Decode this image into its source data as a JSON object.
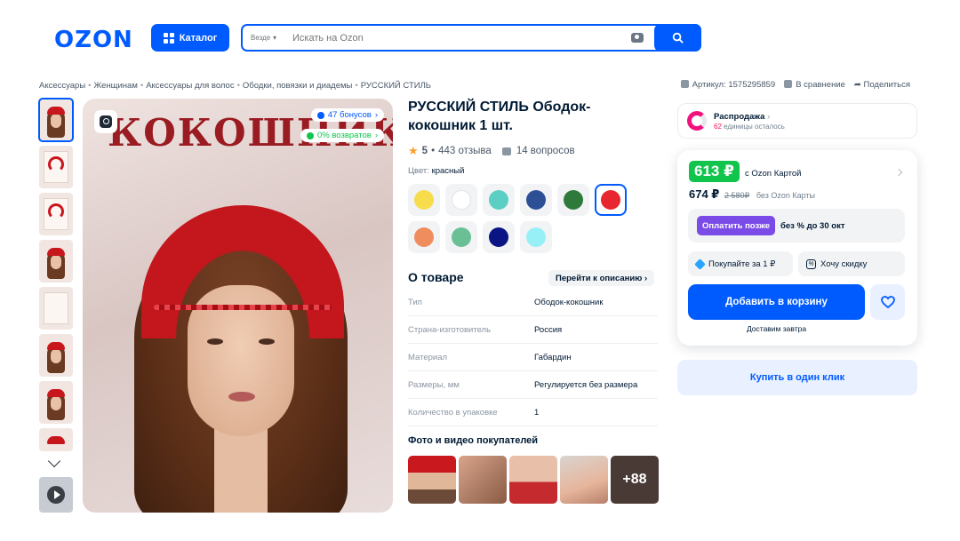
{
  "header": {
    "logo": "OZON",
    "catalog_label": "Каталог",
    "search_scope": "Везде",
    "search_placeholder": "Искать на Ozon"
  },
  "breadcrumbs": [
    "Аксессуары",
    "Женщинам",
    "Аксессуары для волос",
    "Ободки, повязки и диадемы",
    "РУССКИЙ СТИЛЬ"
  ],
  "meta": {
    "article": "Артикул: 1575295859",
    "compare": "В сравнение",
    "share": "Поделиться"
  },
  "gallery": {
    "main_word": "КОКОШНИК",
    "bonus_badge": "47 бонусов",
    "return_badge": "0% возвратов"
  },
  "product": {
    "title": "РУССКИЙ СТИЛЬ Ободок-кокошник 1 шт.",
    "rating": "5",
    "reviews": "443 отзыва",
    "questions": "14 вопросов",
    "color_label": "Цвет:",
    "color_value": "красный",
    "swatches": [
      {
        "color": "#f7dc4c"
      },
      {
        "color": "#ffffff"
      },
      {
        "color": "#5ccfc4"
      },
      {
        "color": "#2d4f96"
      },
      {
        "color": "#2e7a3b"
      },
      {
        "color": "#e8262f",
        "selected": true
      },
      {
        "color": "#f08d5f"
      },
      {
        "color": "#6ac094"
      },
      {
        "color": "#0a1483"
      },
      {
        "color": "#98f0f7"
      }
    ]
  },
  "about": {
    "heading": "О товаре",
    "goto_description": "Перейти к описанию",
    "props": [
      {
        "k": "Тип",
        "v": "Ободок-кокошник"
      },
      {
        "k": "Страна-изготовитель",
        "v": "Россия"
      },
      {
        "k": "Материал",
        "v": "Габардин"
      },
      {
        "k": "Размеры, мм",
        "v": "Регулируется без размера"
      },
      {
        "k": "Количество в упаковке",
        "v": "1"
      }
    ]
  },
  "buyers": {
    "heading": "Фото и видео покупателей",
    "more": "+88"
  },
  "sale": {
    "title": "Распродажа",
    "count": "62",
    "remaining": "единицы осталось"
  },
  "price": {
    "card_price": "613 ₽",
    "card_label": "с Ozon Картой",
    "regular_price": "674 ₽",
    "old_price": "2 580₽",
    "regular_label": "без Ozon Карты",
    "pay_later_button": "Оплатить позже",
    "pay_later_text": "без % до 30 окт",
    "buy_for_one": "Покупайте за 1 ₽",
    "want_discount": "Хочу скидку",
    "add_to_cart": "Добавить в корзину",
    "delivery": "Доставим завтра",
    "one_click": "Купить в один клик"
  },
  "colors": {
    "accent": "#005bff",
    "green": "#10c44c",
    "purple": "#7b4be8",
    "pink": "#f1117e"
  }
}
